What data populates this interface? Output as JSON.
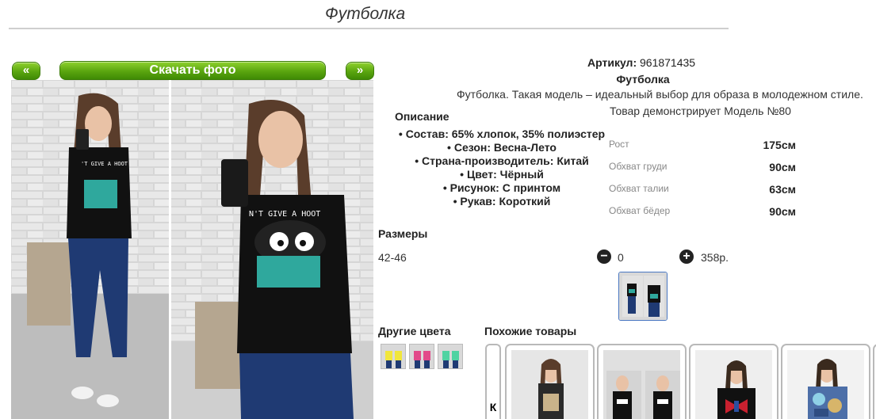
{
  "page": {
    "title": "Футболка"
  },
  "gallery": {
    "prev_label": "«",
    "next_label": "»",
    "download_label": "Скачать фото",
    "tshirt_print": "'T GIVE A HOOT",
    "tshirt_print_right": "N'T GIVE A HOOT"
  },
  "product": {
    "article_label": "Артикул:",
    "article_value": "961871435",
    "name": "Футболка",
    "description": "Футболка. Такая модель – идеальный выбор для образа в молодежном стиле.",
    "model_note": "Товар демонстрирует Модель №80"
  },
  "details": {
    "heading": "Описание",
    "items": [
      "Состав: 65% хлопок, 35% полиэстер",
      "Сезон: Весна-Лето",
      "Страна-производитель: Китай",
      "Цвет: Чёрный",
      "Рисунок: С принтом",
      "Рукав: Короткий"
    ]
  },
  "measurements": [
    {
      "label": "Рост",
      "value": "175см"
    },
    {
      "label": "Обхват груди",
      "value": "90см"
    },
    {
      "label": "Обхват талии",
      "value": "63см"
    },
    {
      "label": "Обхват бёдер",
      "value": "90см"
    }
  ],
  "sizes": {
    "heading": "Размеры",
    "size_label": "42-46",
    "quantity": "0",
    "price": "358р.",
    "minus_symbol": "−",
    "plus_symbol": "+"
  },
  "other_colors": {
    "heading": "Другие цвета",
    "swatches": [
      "#f1e63c",
      "#e24a8a",
      "#4fd3a2"
    ]
  },
  "similar": {
    "heading": "Похожие товары",
    "arrow_label": "К"
  },
  "icons": {
    "minus": "minus-circle-icon",
    "plus": "plus-circle-icon",
    "first": "first-page-icon"
  }
}
